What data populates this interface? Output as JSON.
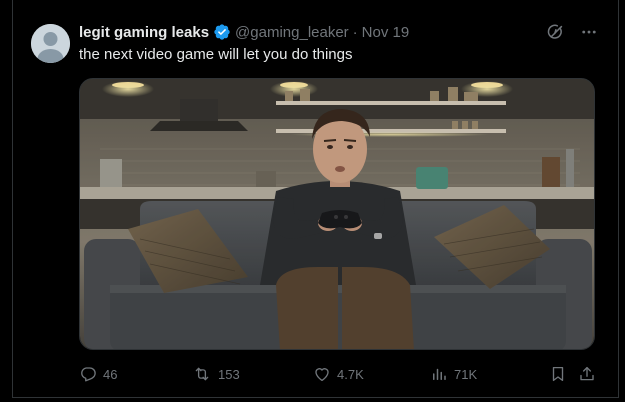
{
  "tweet": {
    "display_name": "legit gaming leaks",
    "handle": "@gaming_leaker",
    "separator": "·",
    "date": "Nov 19",
    "text": "the next video game will let you do things",
    "verified_color": "#1d9bf0"
  },
  "media": {
    "icon": "photo-of-man-holding-game-controller-on-couch"
  },
  "actions": {
    "replies": "46",
    "reposts": "153",
    "likes": "4.7K",
    "views": "71K"
  },
  "icons": {
    "grok": "grok-icon",
    "more": "more-icon",
    "reply": "reply-icon",
    "repost": "repost-icon",
    "like": "heart-icon",
    "views": "views-icon",
    "bookmark": "bookmark-icon",
    "share": "share-icon"
  },
  "colors": {
    "background": "#000000",
    "text": "#e7e9ea",
    "muted": "#71767b",
    "border": "#2f3336"
  }
}
